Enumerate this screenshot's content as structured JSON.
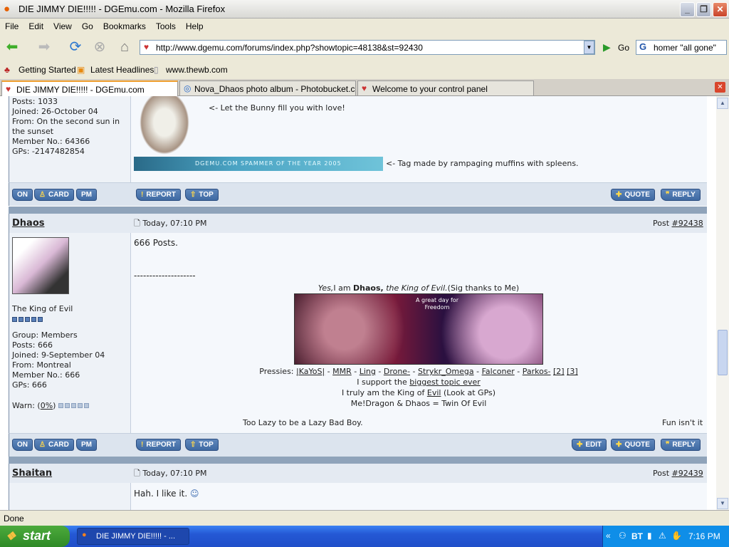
{
  "window": {
    "title": "DIE JIMMY DIE!!!!! - DGEmu.com - Mozilla Firefox"
  },
  "menu": [
    "File",
    "Edit",
    "View",
    "Go",
    "Bookmarks",
    "Tools",
    "Help"
  ],
  "nav": {
    "url": "http://www.dgemu.com/forums/index.php?showtopic=48138&st=92430",
    "go": "Go",
    "search": "homer \"all gone\""
  },
  "bookmarks": [
    "Getting Started",
    "Latest Headlines",
    "www.thewb.com"
  ],
  "tabs": [
    "DIE JIMMY DIE!!!!! - DGEmu.com",
    "Nova_Dhaos photo album - Photobucket.com",
    "Welcome to your control panel"
  ],
  "prev_post": {
    "posts": "Posts: 1033",
    "joined": "Joined: 26-October 04",
    "from": "From: On the second sun in the sunset",
    "member_no": "Member No.: 64366",
    "gps": "GPs: -2147482854",
    "bunny_text": "<- Let the Bunny fill you with love!",
    "banner_text": "DGEMU.COM SPAMMER OF THE YEAR 2005",
    "tag_text": "<- Tag made by rampaging muffins with spleens."
  },
  "buttons": {
    "on": "ON",
    "card": "CARD",
    "pm": "PM",
    "report": "REPORT",
    "top": "TOP",
    "quote": "QUOTE",
    "reply": "REPLY",
    "edit": "EDIT"
  },
  "post1": {
    "author": "Dhaos",
    "date": "Today, 07:10 PM",
    "post_label": "Post",
    "post_no": "#92438",
    "title": "The King of Evil",
    "group": "Group: Members",
    "posts": "Posts: 666",
    "joined": "Joined: 9-September 04",
    "from": "From: Montreal",
    "member_no": "Member No.: 666",
    "gps": "GPs: 666",
    "warn_label": "Warn: (",
    "warn_pct": "0%",
    "warn_end": ")",
    "rank_pips": 5,
    "warn_level": 0,
    "body": "666 Posts.",
    "sep": "--------------------",
    "sig": {
      "yes": "Yes,",
      "iam": "I am ",
      "dhaos": "Dhaos,",
      "king": " the King of Evil.",
      "thanks": "(Sig thanks to Me)",
      "img_text": "A great day for Freedom",
      "pressies_label": "Pressies: ",
      "pressies": [
        "|KaYoS|",
        "MMR",
        "Ling",
        "Drone-",
        "Strykr_Omega",
        "Falconer",
        "Parkos-"
      ],
      "extra": [
        "[2]",
        "[3]"
      ],
      "support_pre": "I support the ",
      "support_link": "biggest topic ever",
      "truly_pre": "I truly am the King of ",
      "truly_link": "Evil",
      "truly_post": " (Look at GPs)",
      "twin": "Me!Dragon & Dhaos = Twin Of Evil",
      "lazy": "Too Lazy to be a Lazy Bad Boy.",
      "fun": "Fun isn't it"
    }
  },
  "post2": {
    "author": "Shaitan",
    "date": "Today, 07:10 PM",
    "post_label": "Post",
    "post_no": "#92439",
    "body": "Hah. I like it."
  },
  "status": "Done",
  "taskbar": {
    "start": "start",
    "item": "DIE JIMMY DIE!!!!! - ...",
    "tray_bt": "BT",
    "clock": "7:16 PM"
  }
}
